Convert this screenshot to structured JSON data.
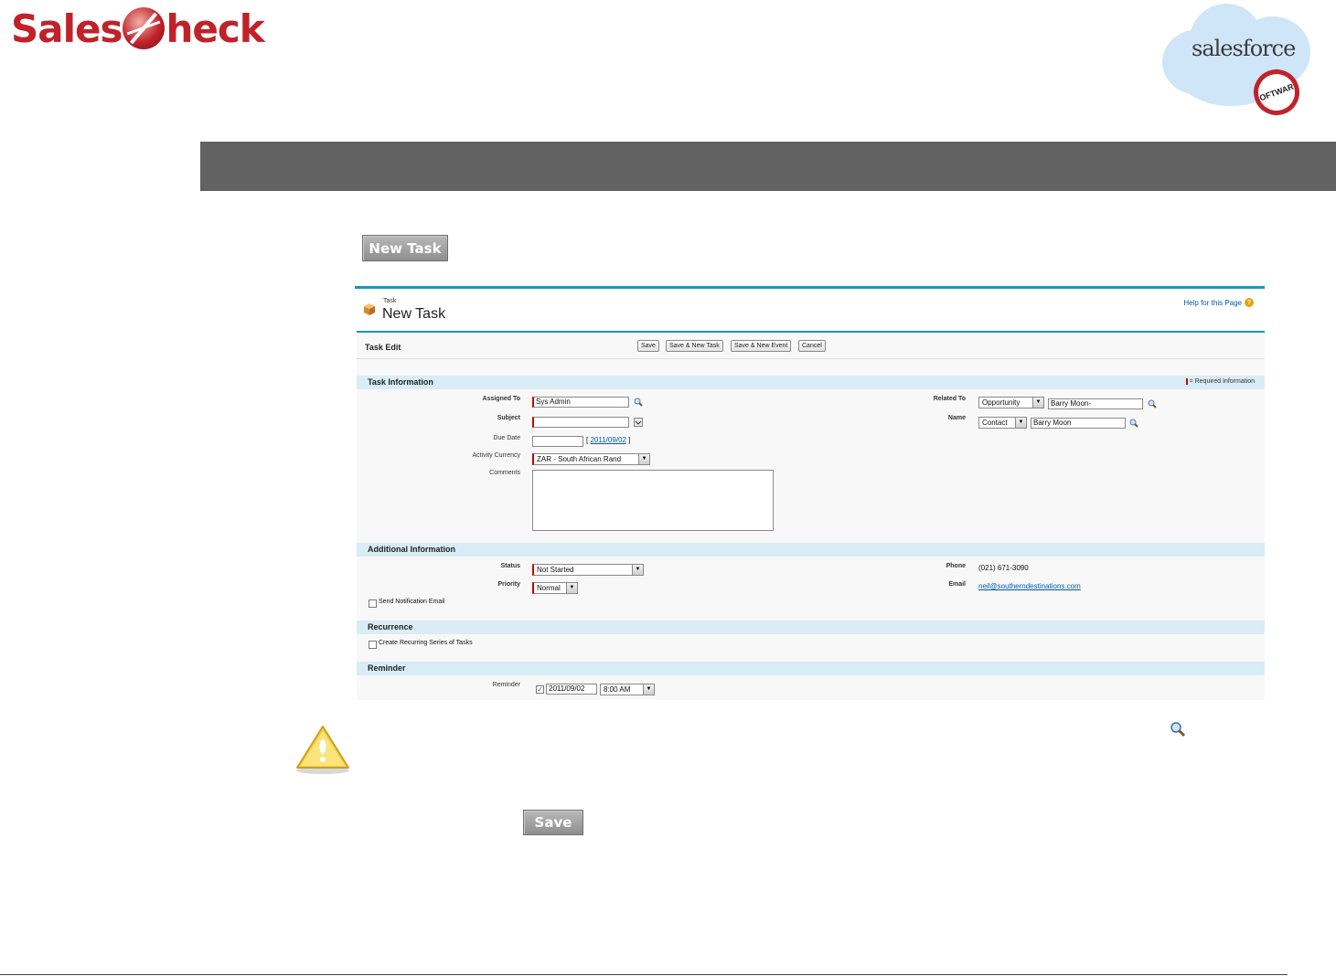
{
  "logo": {
    "part1": "Sales",
    "part2": "heck"
  },
  "salesforce_logo": {
    "word": "salesforce",
    "badge": "SOFTWARE"
  },
  "new_task_button": "New Task",
  "save_button": "Save",
  "sf": {
    "breadcrumb": "Task",
    "title": "New Task",
    "help_link": "Help for this Page",
    "edit_title": "Task Edit",
    "buttons": [
      "Save",
      "Save & New Task",
      "Save & New Event",
      "Cancel"
    ],
    "required_legend": "= Required Information",
    "sections": {
      "task_info": "Task Information",
      "additional": "Additional Information",
      "recurrence": "Recurrence",
      "reminder": "Reminder"
    },
    "fields": {
      "assigned_to": {
        "label": "Assigned To",
        "value": "Sys Admin"
      },
      "subject": {
        "label": "Subject",
        "value": ""
      },
      "due_date": {
        "label": "Due Date",
        "value": "",
        "link": "2011/09/02",
        "open": "[",
        "close": "]"
      },
      "currency": {
        "label": "Activity Currency",
        "value": "ZAR - South African Rand"
      },
      "comments": {
        "label": "Comments",
        "value": ""
      },
      "related_to": {
        "label": "Related To",
        "type": "Opportunity",
        "value": "Barry Moon-"
      },
      "name": {
        "label": "Name",
        "type": "Contact",
        "value": "Barry Moon"
      },
      "status": {
        "label": "Status",
        "value": "Not Started"
      },
      "priority": {
        "label": "Priority",
        "value": "Normal"
      },
      "send_notification": {
        "label": "Send Notification Email",
        "checked": false
      },
      "phone": {
        "label": "Phone",
        "value": "(021) 671-3090"
      },
      "email": {
        "label": "Email",
        "value": "neil@southerndestinations.com"
      },
      "recurring": {
        "label": "Create Recurring Series of Tasks",
        "checked": false
      },
      "reminder": {
        "label": "Reminder",
        "checked": true,
        "date": "2011/09/02",
        "time": "8:00 AM"
      }
    }
  },
  "colors": {
    "brand_red": "#c0222a",
    "sf_blue": "#1797c0",
    "section_bg": "#d9edf6",
    "gray_bar": "#626262"
  }
}
